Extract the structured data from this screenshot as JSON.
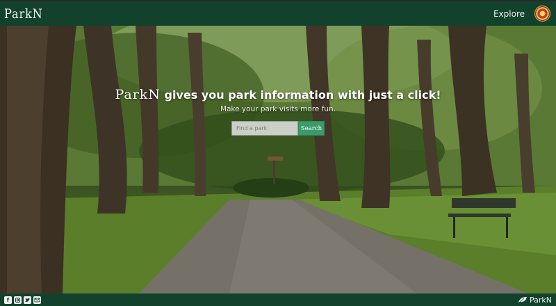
{
  "navbar": {
    "logo": "ParkN",
    "explore_label": "Explore"
  },
  "hero": {
    "brand": "ParkN",
    "headline_rest": " gives you park information with just a click!",
    "subline": "Make your park visits more fun.",
    "search_placeholder": "Find a park",
    "search_button": "Search"
  },
  "footer": {
    "socials": [
      "facebook-icon",
      "instagram-icon",
      "twitter-icon",
      "mail-icon"
    ],
    "brand": "ParkN"
  },
  "colors": {
    "nav_bg": "#12422c",
    "button": "#3a9b6a"
  }
}
